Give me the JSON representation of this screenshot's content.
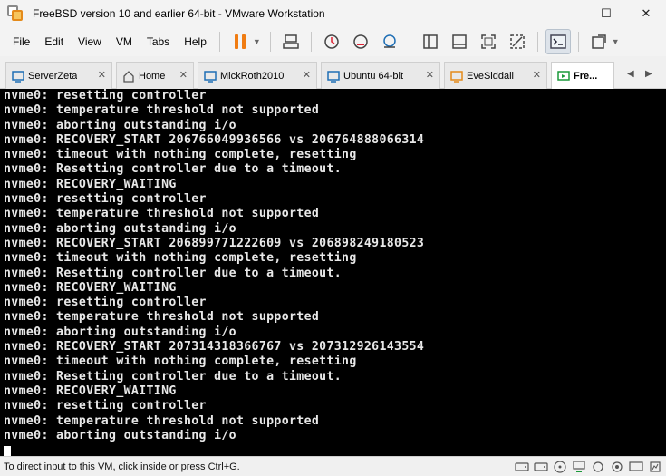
{
  "window": {
    "title": "FreeBSD version 10 and earlier 64-bit - VMware Workstation",
    "minimize": "—",
    "maximize": "☐",
    "close": "✕"
  },
  "menu": {
    "items": [
      "File",
      "Edit",
      "View",
      "VM",
      "Tabs",
      "Help"
    ]
  },
  "tabs": [
    {
      "label": "ServerZeta",
      "icon": "vm-icon"
    },
    {
      "label": "Home",
      "icon": "home-icon"
    },
    {
      "label": "MickRoth2010",
      "icon": "vm-icon"
    },
    {
      "label": "Ubuntu 64-bit",
      "icon": "vm-icon"
    },
    {
      "label": "EveSiddall",
      "icon": "vm-icon"
    },
    {
      "label": "Fre...",
      "icon": "vm-icon"
    }
  ],
  "tab_close": "✕",
  "tab_nav": {
    "prev": "◀",
    "next": "▶"
  },
  "console": {
    "lines": [
      "nvme0: resetting controller",
      "nvme0: temperature threshold not supported",
      "nvme0: aborting outstanding i/o",
      "nvme0: RECOVERY_START 206766049936566 vs 206764888066314",
      "nvme0: timeout with nothing complete, resetting",
      "nvme0: Resetting controller due to a timeout.",
      "nvme0: RECOVERY_WAITING",
      "nvme0: resetting controller",
      "nvme0: temperature threshold not supported",
      "nvme0: aborting outstanding i/o",
      "nvme0: RECOVERY_START 206899771222609 vs 206898249180523",
      "nvme0: timeout with nothing complete, resetting",
      "nvme0: Resetting controller due to a timeout.",
      "nvme0: RECOVERY_WAITING",
      "nvme0: resetting controller",
      "nvme0: temperature threshold not supported",
      "nvme0: aborting outstanding i/o",
      "nvme0: RECOVERY_START 207314318366767 vs 207312926143554",
      "nvme0: timeout with nothing complete, resetting",
      "nvme0: Resetting controller due to a timeout.",
      "nvme0: RECOVERY_WAITING",
      "nvme0: resetting controller",
      "nvme0: temperature threshold not supported",
      "nvme0: aborting outstanding i/o"
    ]
  },
  "status": {
    "text": "To direct input to this VM, click inside or press Ctrl+G."
  },
  "colors": {
    "accent": "#f07c12",
    "console_bg": "#000000",
    "console_fg": "#e8e8e8"
  }
}
